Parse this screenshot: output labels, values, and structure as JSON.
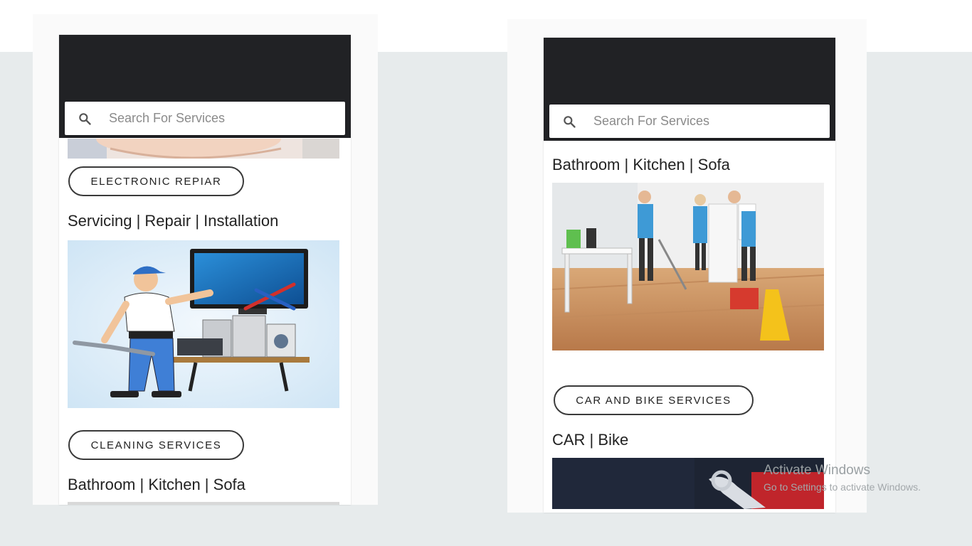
{
  "left_phone": {
    "search_placeholder": "Search For Services",
    "electronic_repair_label": "ELECTRONIC REPIAR",
    "electronic_subtitle": "Servicing | Repair | Installation",
    "cleaning_label": "CLEANING SERVICES",
    "cleaning_subtitle": "Bathroom | Kitchen | Sofa"
  },
  "right_phone": {
    "search_placeholder": "Search For Services",
    "cleaning_subtitle": "Bathroom | Kitchen | Sofa",
    "car_bike_label": "CAR AND BIKE SERVICES",
    "car_bike_subtitle": "CAR | Bike"
  },
  "watermark": {
    "title": "Activate Windows",
    "subtitle": "Go to Settings to activate Windows."
  },
  "colors": {
    "header": "#212225",
    "background": "#e7ebec"
  },
  "icons": [
    "search-icon"
  ]
}
